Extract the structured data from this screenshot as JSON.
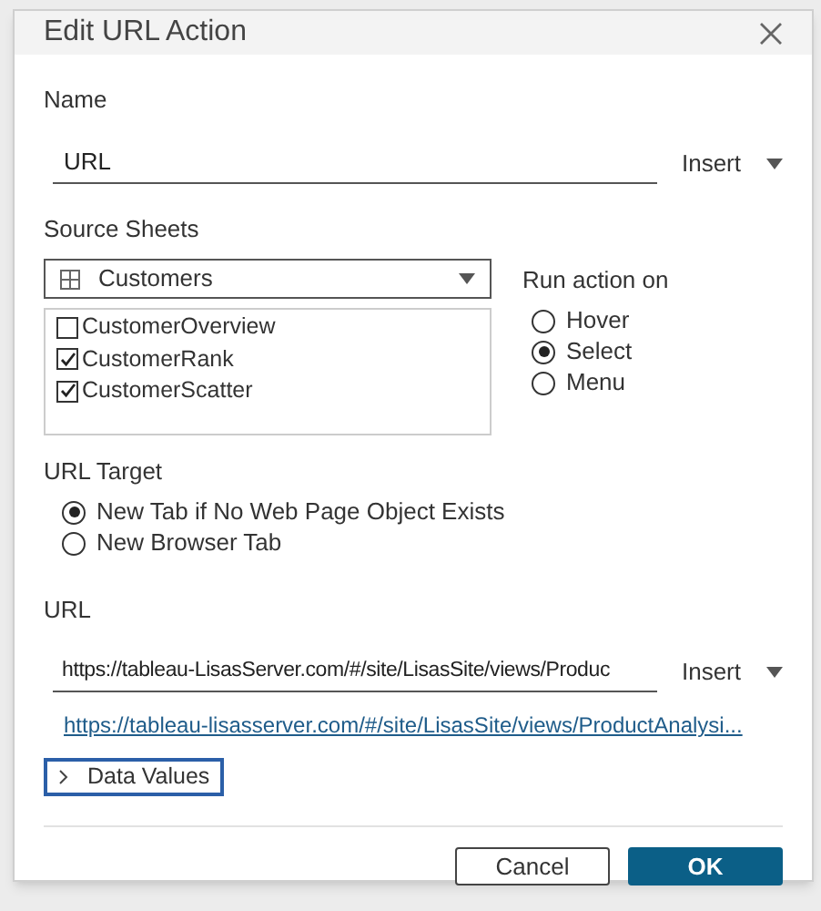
{
  "dialog": {
    "title": "Edit URL Action"
  },
  "name_section": {
    "label": "Name",
    "value": "URL",
    "insert": "Insert"
  },
  "source_sheets": {
    "label": "Source Sheets",
    "dropdown": "Customers",
    "sheets": [
      {
        "label": "CustomerOverview",
        "checked": false
      },
      {
        "label": "CustomerRank",
        "checked": true
      },
      {
        "label": "CustomerScatter",
        "checked": true
      }
    ]
  },
  "run_action": {
    "label": "Run action on",
    "options": [
      {
        "label": "Hover",
        "selected": false
      },
      {
        "label": "Select",
        "selected": true
      },
      {
        "label": "Menu",
        "selected": false
      }
    ]
  },
  "url_target": {
    "label": "URL Target",
    "options": [
      {
        "label": "New Tab if No Web Page Object Exists",
        "selected": true
      },
      {
        "label": "New Browser Tab",
        "selected": false
      }
    ]
  },
  "url_section": {
    "label": "URL",
    "value": "https://tableau-LisasServer.com/#/site/LisasSite/views/Produc",
    "insert": "Insert",
    "preview": "https://tableau-lisasserver.com/#/site/LisasSite/views/ProductAnalysi...",
    "data_values": {
      "label": "Data Values",
      "expanded": false
    }
  },
  "buttons": [
    {
      "label": "Cancel",
      "kind": "secondary"
    },
    {
      "label": "OK",
      "kind": "primary"
    }
  ]
}
